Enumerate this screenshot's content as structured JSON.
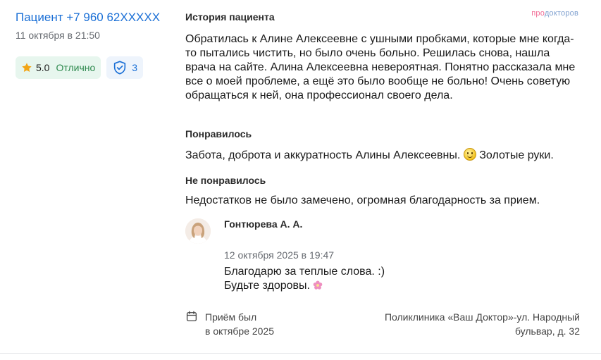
{
  "review": {
    "patient_name": "Пациент +7 960 62XXXXX",
    "date": "11 октября в 21:50",
    "rating": "5.0",
    "rating_grade": "Отлично",
    "verify_count": "3",
    "brand_part1": "про",
    "brand_part2": "докторов",
    "story_heading": "История пациента",
    "story_text": "Обратилась к Алине Алексеевне с ушными пробками, которые мне когда-то пытались чистить, но было очень больно. Решилась снова, нашла врача на сайте. Алина Алексеевна невероятная. Понятно рассказала мне все о моей проблеме, а ещё это было вообще не больно! Очень советую обращаться к ней, она профессионал своего дела.",
    "liked_heading": "Понравилось",
    "liked_text_1": "Забота, доброта и аккуратность Алины Алексеевны.",
    "liked_text_2": "Золотые руки.",
    "disliked_heading": "Не понравилось",
    "disliked_text": "Недостатков не было замечено, огромная благодарность за прием."
  },
  "reply": {
    "doctor_name": "Гонтюрева А. А.",
    "date": "12 октября 2025 в 19:47",
    "line1": "Благодарю за теплые слова. :)",
    "line2": "Будьте здоровы."
  },
  "footer": {
    "visit_line1": "Приём был",
    "visit_line2": "в октябре 2025",
    "clinic": "Поликлиника «Ваш Доктор»-ул. Народный бульвар, д. 32"
  },
  "colors": {
    "link": "#1a6fd6",
    "rating_bg": "#e7f6ee",
    "rating_text": "#2f8a4f",
    "star": "#f2a516",
    "verify_bg": "#eef4fc"
  },
  "icons": [
    "star-icon",
    "shield-check-icon",
    "smile-emoji-icon",
    "flower-emoji-icon",
    "calendar-icon"
  ]
}
